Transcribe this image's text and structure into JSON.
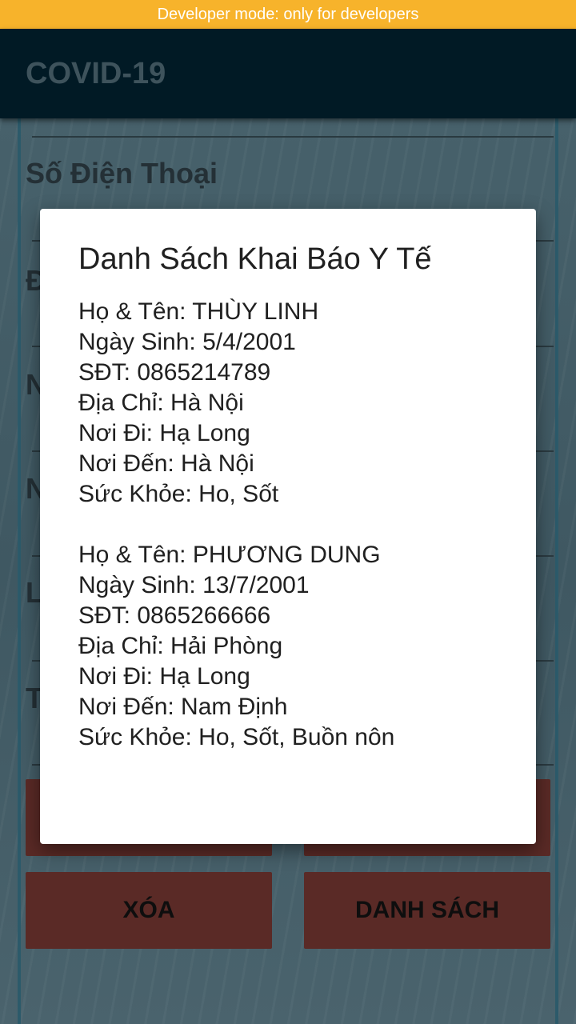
{
  "system": {
    "dev_banner": "Developer mode: only for developers"
  },
  "appbar": {
    "title": "COVID-19"
  },
  "form": {
    "labels": [
      "Số Điện Thoại",
      "Đ",
      "N",
      "N",
      "L",
      "T"
    ],
    "buttons": {
      "hidden_left": "",
      "hidden_right": "",
      "delete": "XÓA",
      "list": "DANH SÁCH"
    }
  },
  "dialog": {
    "title": "Danh Sách Khai Báo Y Tế",
    "entries": [
      {
        "name": "Họ & Tên: THÙY LINH",
        "dob": "Ngày Sinh: 5/4/2001",
        "phone": "SĐT: 0865214789",
        "address": "Địa Chỉ: Hà Nội",
        "from": "Nơi Đi: Hạ Long",
        "to": "Nơi Đến: Hà Nội",
        "health": "Sức Khỏe: Ho, Sốt"
      },
      {
        "name": "Họ & Tên: PHƯƠNG DUNG",
        "dob": "Ngày Sinh: 13/7/2001",
        "phone": "SĐT: 0865266666",
        "address": "Địa Chỉ: Hải Phòng",
        "from": "Nơi Đi: Hạ Long",
        "to": "Nơi Đến: Nam Định",
        "health": "Sức Khỏe: Ho, Sốt, Buồn nôn"
      }
    ]
  }
}
